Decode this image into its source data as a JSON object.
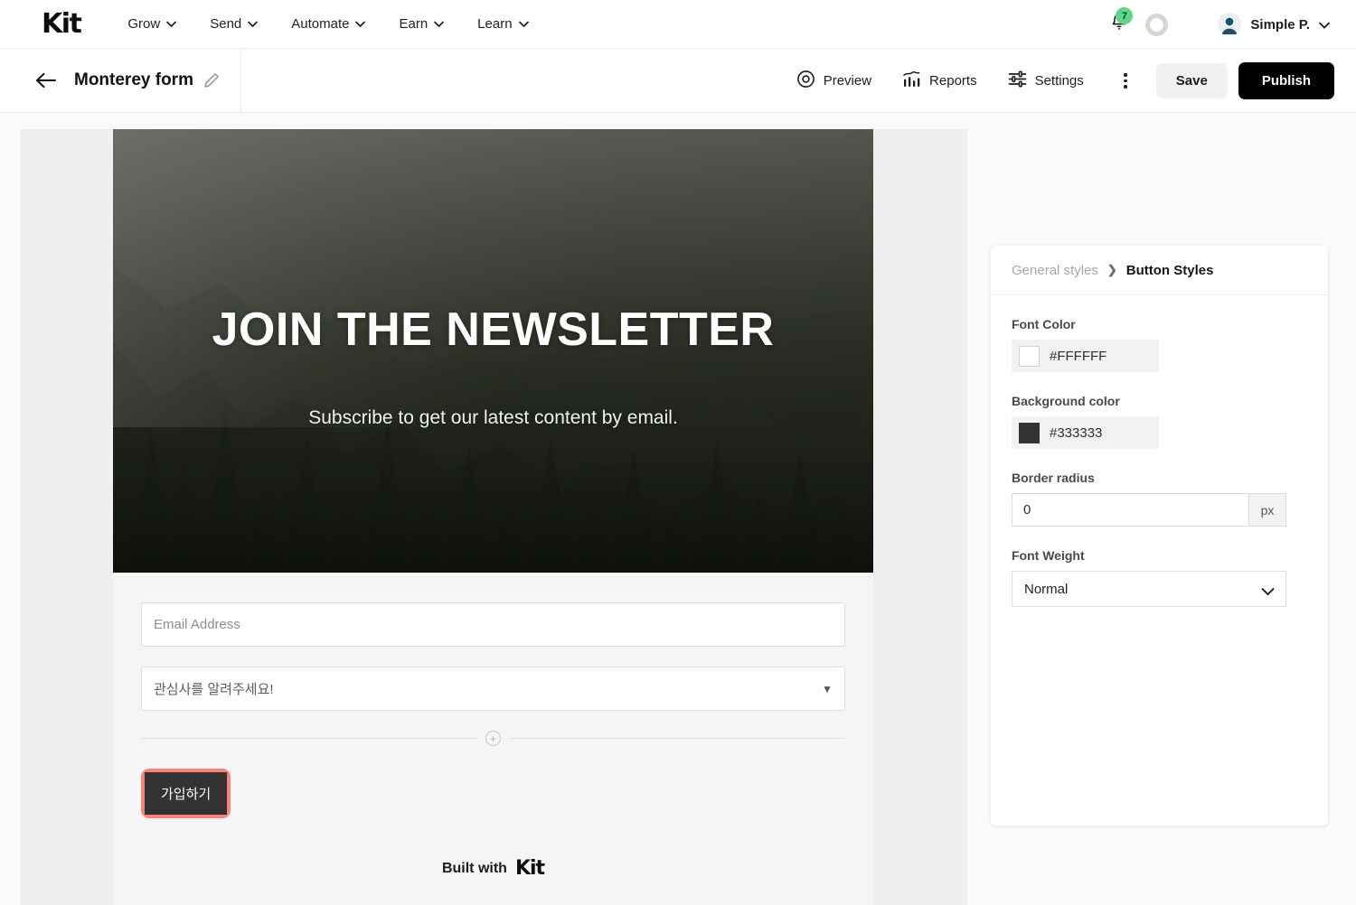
{
  "topnav": {
    "brand": "Kit",
    "items": [
      {
        "label": "Grow",
        "icon": "chevron-down-icon"
      },
      {
        "label": "Send",
        "icon": "chevron-down-icon"
      },
      {
        "label": "Automate",
        "icon": "chevron-down-icon"
      },
      {
        "label": "Earn",
        "icon": "chevron-down-icon"
      },
      {
        "label": "Learn",
        "icon": "chevron-down-icon"
      }
    ],
    "notifications": {
      "icon": "bell-icon",
      "count": "7",
      "badge_color": "#5FD68A"
    },
    "progress_ring": {
      "icon": "progress-ring-icon"
    },
    "user": {
      "name": "Simple P.",
      "avatar_icon": "avatar-icon",
      "caret_icon": "chevron-down-icon"
    }
  },
  "toolbar": {
    "back_icon": "arrow-left-icon",
    "title": "Monterey form",
    "edit_icon": "pencil-icon",
    "actions": [
      {
        "label": "Preview",
        "icon": "eye-icon"
      },
      {
        "label": "Reports",
        "icon": "bar-chart-icon"
      },
      {
        "label": "Settings",
        "icon": "sliders-icon"
      }
    ],
    "more_icon": "kebab-menu-icon",
    "save_label": "Save",
    "publish_label": "Publish"
  },
  "form_preview": {
    "headline": "JOIN THE NEWSLETTER",
    "subheadline": "Subscribe to get our latest content by email.",
    "email_placeholder": "Email Address",
    "select_placeholder": "관심사를 알려주세요!",
    "select_caret_icon": "caret-down-icon",
    "add_block_icon": "plus-circle-icon",
    "submit_label": "가입하기",
    "submit_selected": true,
    "selection_color": "#FB8279",
    "submit_bg": "#333333",
    "submit_fg": "#FFFFFF",
    "footer_prefix": "Built with",
    "footer_brand": "Kit"
  },
  "panel": {
    "breadcrumb_parent": "General styles",
    "breadcrumb_sep_icon": "chevron-right-icon",
    "breadcrumb_current": "Button Styles",
    "font_color": {
      "label": "Font Color",
      "value": "#FFFFFF",
      "swatch": "#FFFFFF"
    },
    "background_color": {
      "label": "Background color",
      "value": "#333333",
      "swatch": "#333333"
    },
    "border_radius": {
      "label": "Border radius",
      "value": "0",
      "unit": "px"
    },
    "font_weight": {
      "label": "Font Weight",
      "value": "Normal",
      "caret_icon": "chevron-down-icon"
    }
  }
}
